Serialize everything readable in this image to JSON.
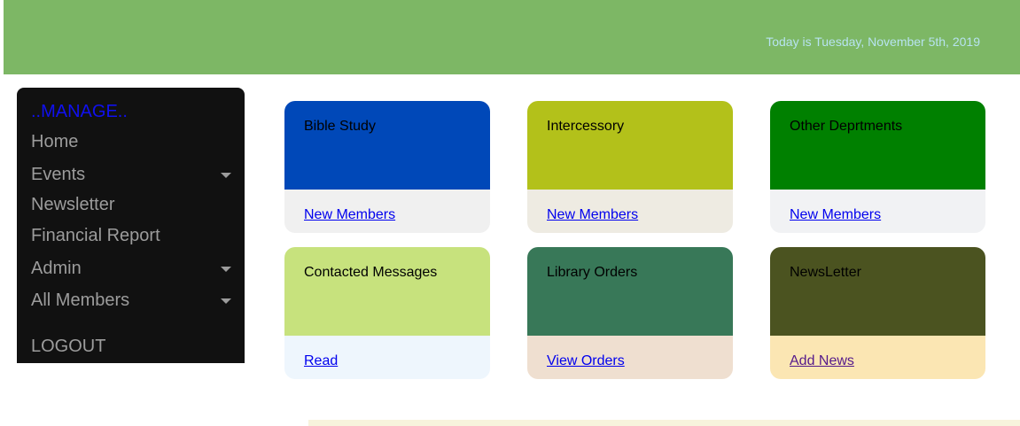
{
  "header": {
    "date_text": "Today is Tuesday, November 5th, 2019",
    "bg_color": "#7db765"
  },
  "sidebar": {
    "title": "..MANAGE..",
    "items": [
      {
        "label": "Home",
        "has_dropdown": false
      },
      {
        "label": "Events",
        "has_dropdown": true
      },
      {
        "label": "Newsletter",
        "has_dropdown": false
      },
      {
        "label": "Financial Report",
        "has_dropdown": false
      },
      {
        "label": "Admin",
        "has_dropdown": true
      },
      {
        "label": "All Members",
        "has_dropdown": true
      }
    ],
    "logout": "LOGOUT"
  },
  "cards": [
    {
      "title": "Bible Study",
      "link": "New Members",
      "top_color": "#0048b8",
      "bottom_color": "#f0f0f0"
    },
    {
      "title": "Intercessory",
      "link": "New Members",
      "top_color": "#b3c11a",
      "bottom_color": "#eeebe2"
    },
    {
      "title": "Other Deprtments",
      "link": "New Members",
      "top_color": "#008000",
      "bottom_color": "#f1f2f4"
    },
    {
      "title": "Contacted Messages",
      "link": "Read",
      "top_color": "#c7e27d",
      "bottom_color": "#eef6fd"
    },
    {
      "title": "Library Orders",
      "link": "View Orders",
      "top_color": "#387858",
      "bottom_color": "#efdfd0"
    },
    {
      "title": "NewsLetter",
      "link": "Add News",
      "top_color": "#4b5320",
      "bottom_color": "#fbe6b3"
    }
  ]
}
